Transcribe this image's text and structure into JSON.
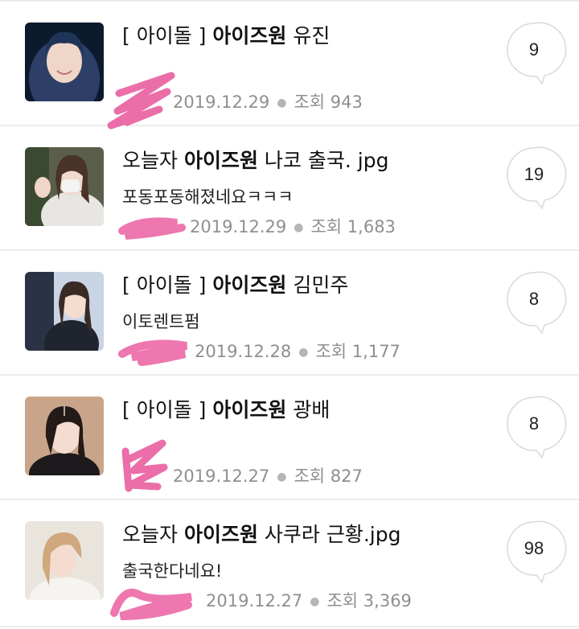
{
  "posts": [
    {
      "title_prefix": "[ 아이돌 ] ",
      "title_keyword": "아이즈원",
      "title_suffix": " 유진",
      "preview": "",
      "date": "2019.12.29",
      "views_label": "조회",
      "views": "943",
      "comments": "9"
    },
    {
      "title_prefix": "오늘자 ",
      "title_keyword": "아이즈원",
      "title_suffix": " 나코 출국. jpg",
      "preview": "포동포동해졌네요ㅋㅋㅋ",
      "date": "2019.12.29",
      "views_label": "조회",
      "views": "1,683",
      "comments": "19"
    },
    {
      "title_prefix": "[ 아이돌 ] ",
      "title_keyword": "아이즈원",
      "title_suffix": " 김민주",
      "preview": "이토렌트펌",
      "date": "2019.12.28",
      "views_label": "조회",
      "views": "1,177",
      "comments": "8"
    },
    {
      "title_prefix": "[ 아이돌 ] ",
      "title_keyword": "아이즈원",
      "title_suffix": " 광배",
      "preview": "",
      "date": "2019.12.27",
      "views_label": "조회",
      "views": "827",
      "comments": "8"
    },
    {
      "title_prefix": "오늘자 ",
      "title_keyword": "아이즈원",
      "title_suffix": " 사쿠라 근황.jpg",
      "preview": "출국한다네요!",
      "date": "2019.12.27",
      "views_label": "조회",
      "views": "3,369",
      "comments": "98"
    }
  ],
  "colors": {
    "redaction_scribble": "#e8559a",
    "meta_text": "#8f8f8f",
    "divider": "#ececec"
  },
  "icons": {
    "comment_bubble": "speech-bubble-icon"
  }
}
